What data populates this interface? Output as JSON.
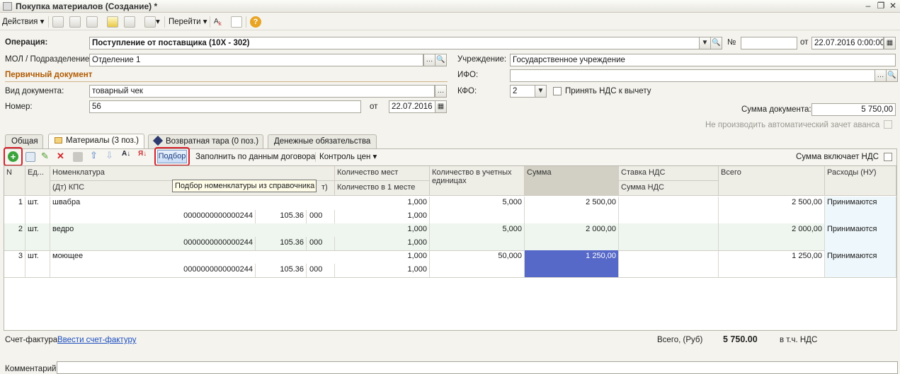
{
  "window": {
    "title": "Покупка материалов (Создание) *"
  },
  "toolbar": {
    "actions": "Действия",
    "goto": "Перейти",
    "help_icon": "?"
  },
  "form": {
    "operation_label": "Операция:",
    "operation_value": "Поступление от поставщика (10Х - 302)",
    "number_label": "№",
    "number_value": "",
    "from_label": "от",
    "date_value": "22.07.2016  0:00:00",
    "mol_label": "МОЛ / Подразделение:",
    "mol_value": "Отделение 1",
    "institution_label": "Учреждение:",
    "institution_value": "Государственное учреждение",
    "primary_doc_header": "Первичный документ",
    "ifo_label": "ИФО:",
    "ifo_value": "",
    "doc_type_label": "Вид документа:",
    "doc_type_value": "товарный чек",
    "kfo_label": "КФО:",
    "kfo_value": "2",
    "accept_vat_label": "Принять НДС к вычету",
    "doc_number_label": "Номер:",
    "doc_number_value": "56",
    "doc_from_label": "от",
    "doc_date_value": "22.07.2016",
    "doc_sum_label": "Сумма документа:",
    "doc_sum_value": "5 750,00",
    "no_advance_label": "Не производить автоматический зачет аванса"
  },
  "tabs": [
    {
      "label": "Общая"
    },
    {
      "label": "Материалы (3 поз.)"
    },
    {
      "label": "Возвратная тара (0 поз.)"
    },
    {
      "label": "Денежные обязательства"
    }
  ],
  "grid_toolbar": {
    "podbor": "Подбор",
    "fill_by_contract": "Заполнить по данным договора",
    "price_control": "Контроль цен",
    "sum_includes_vat": "Сумма включает НДС"
  },
  "tooltip": "Подбор номенклатуры из справочника",
  "grid": {
    "headers": {
      "n": "N",
      "unit": "Ед...",
      "nomenclature": "Номенклатура",
      "kps": "(Дт) КПС",
      "kps_tail": "т)",
      "qty_places": "Количество мест",
      "qty_in_place": "Количество в 1 месте",
      "qty_units": "Количество в учетных единицах",
      "sum": "Сумма",
      "vat_rate": "Ставка НДС",
      "vat_sum": "Сумма НДС",
      "total": "Всего",
      "expenses": "Расходы (НУ)"
    },
    "rows": [
      {
        "n": "1",
        "unit": "шт.",
        "name": "швабра",
        "kps": "0000000000000244",
        "kosgu": "105.36",
        "code": "000",
        "places": "1,000",
        "in_place": "1,000",
        "qty": "5,000",
        "sum": "2 500,00",
        "total": "2 500,00",
        "expenses": "Принимаются"
      },
      {
        "n": "2",
        "unit": "шт.",
        "name": "ведро",
        "kps": "0000000000000244",
        "kosgu": "105.36",
        "code": "000",
        "places": "1,000",
        "in_place": "1,000",
        "qty": "5,000",
        "sum": "2 000,00",
        "total": "2 000,00",
        "expenses": "Принимаются"
      },
      {
        "n": "3",
        "unit": "шт.",
        "name": "моющее",
        "kps": "0000000000000244",
        "kosgu": "105.36",
        "code": "000",
        "places": "1,000",
        "in_place": "1,000",
        "qty": "50,000",
        "sum": "1 250,00",
        "total": "1 250,00",
        "expenses": "Принимаются"
      }
    ]
  },
  "footer": {
    "invoice_label": "Счет-фактура:",
    "invoice_link": "Ввести счет-фактуру",
    "total_label": "Всего, (Руб)",
    "total_value": "5 750.00",
    "vat_label": "в т.ч. НДС",
    "comment_label": "Комментарий:"
  },
  "colors": {
    "accent_orange": "#b05a00",
    "selected_cell": "#5668c8",
    "highlight_red": "#d6212c"
  }
}
